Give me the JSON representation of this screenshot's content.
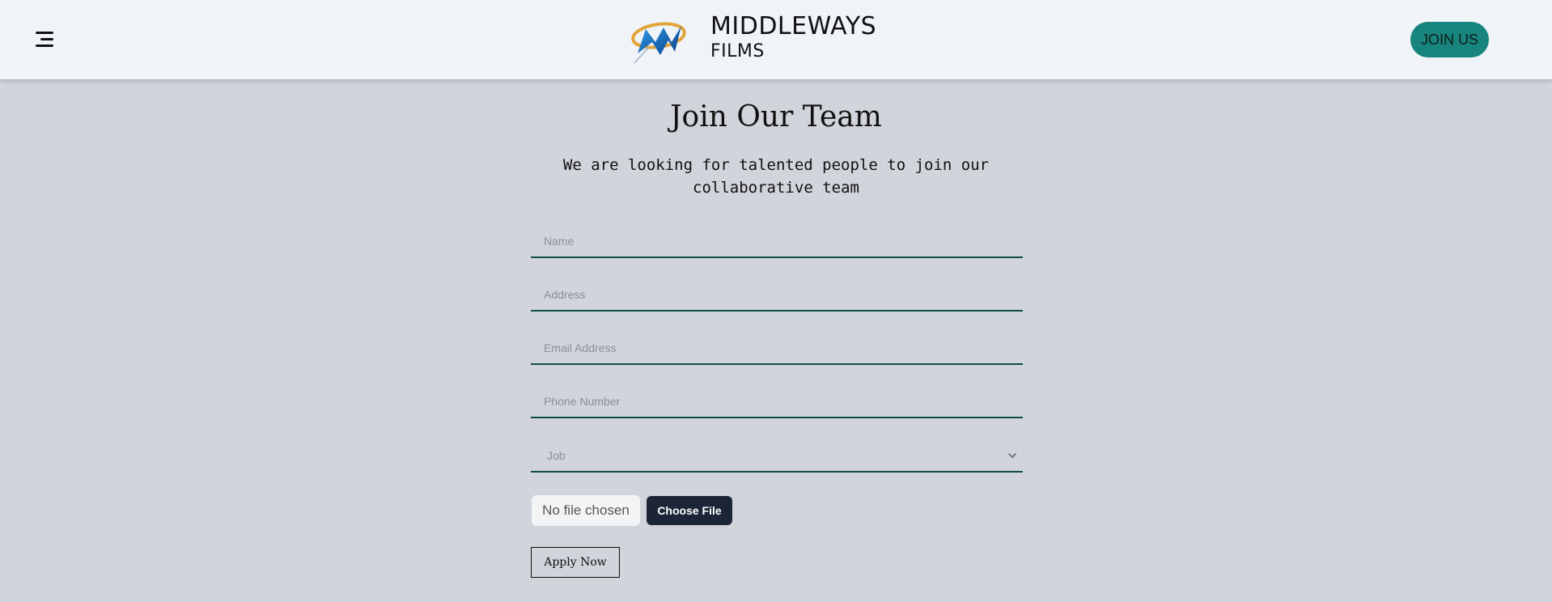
{
  "header": {
    "menu_icon": "hamburger-menu-icon",
    "brand_name": "MIDDLEWAYS",
    "brand_sub": "FILMS",
    "logo_icon": "middleways-logo",
    "join_label": "JOIN US",
    "join_color": "#17857d"
  },
  "main": {
    "title": "Join Our Team",
    "subtitle": "We are looking for talented people to join our collaborative team",
    "fields": {
      "name_placeholder": "Name",
      "address_placeholder": "Address",
      "email_placeholder": "Email Address",
      "phone_placeholder": "Phone Number",
      "job_placeholder": "Job"
    },
    "file": {
      "status": "No file chosen",
      "button": "Choose File"
    },
    "apply_label": "Apply Now"
  }
}
